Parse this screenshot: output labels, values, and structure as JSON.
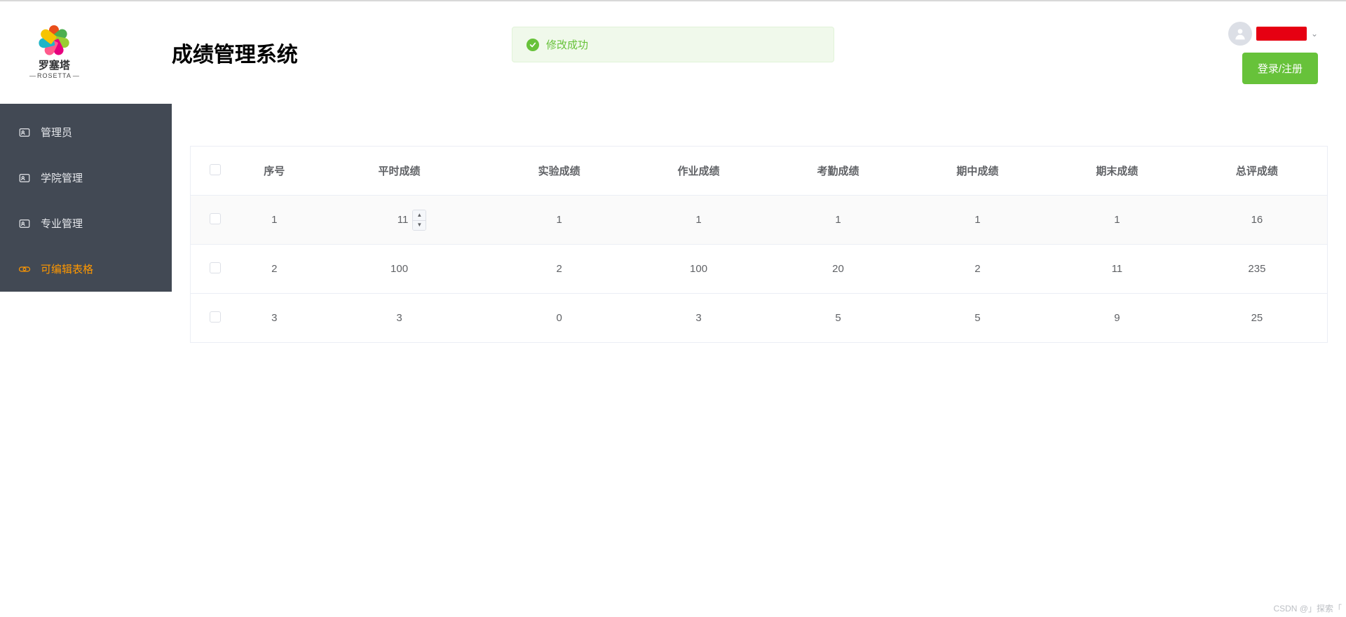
{
  "header": {
    "logo_name": "罗塞塔",
    "logo_sub": "ROSETTA",
    "app_title": "成绩管理系统"
  },
  "toast": {
    "message": "修改成功"
  },
  "user": {
    "login_button": "登录/注册"
  },
  "sidebar": {
    "items": [
      {
        "label": "管理员"
      },
      {
        "label": "学院管理"
      },
      {
        "label": "专业管理"
      },
      {
        "label": "可编辑表格"
      }
    ]
  },
  "table": {
    "columns": [
      "序号",
      "平时成绩",
      "实验成绩",
      "作业成绩",
      "考勤成绩",
      "期中成绩",
      "期末成绩",
      "总评成绩"
    ],
    "rows": [
      {
        "idx": "1",
        "usual": "11",
        "exp": "1",
        "hw": "1",
        "att": "1",
        "mid": "1",
        "final": "1",
        "total": "16",
        "editing": true
      },
      {
        "idx": "2",
        "usual": "100",
        "exp": "2",
        "hw": "100",
        "att": "20",
        "mid": "2",
        "final": "11",
        "total": "235",
        "editing": false
      },
      {
        "idx": "3",
        "usual": "3",
        "exp": "0",
        "hw": "3",
        "att": "5",
        "mid": "5",
        "final": "9",
        "total": "25",
        "editing": false
      }
    ]
  },
  "watermark": "CSDN @」探索「"
}
